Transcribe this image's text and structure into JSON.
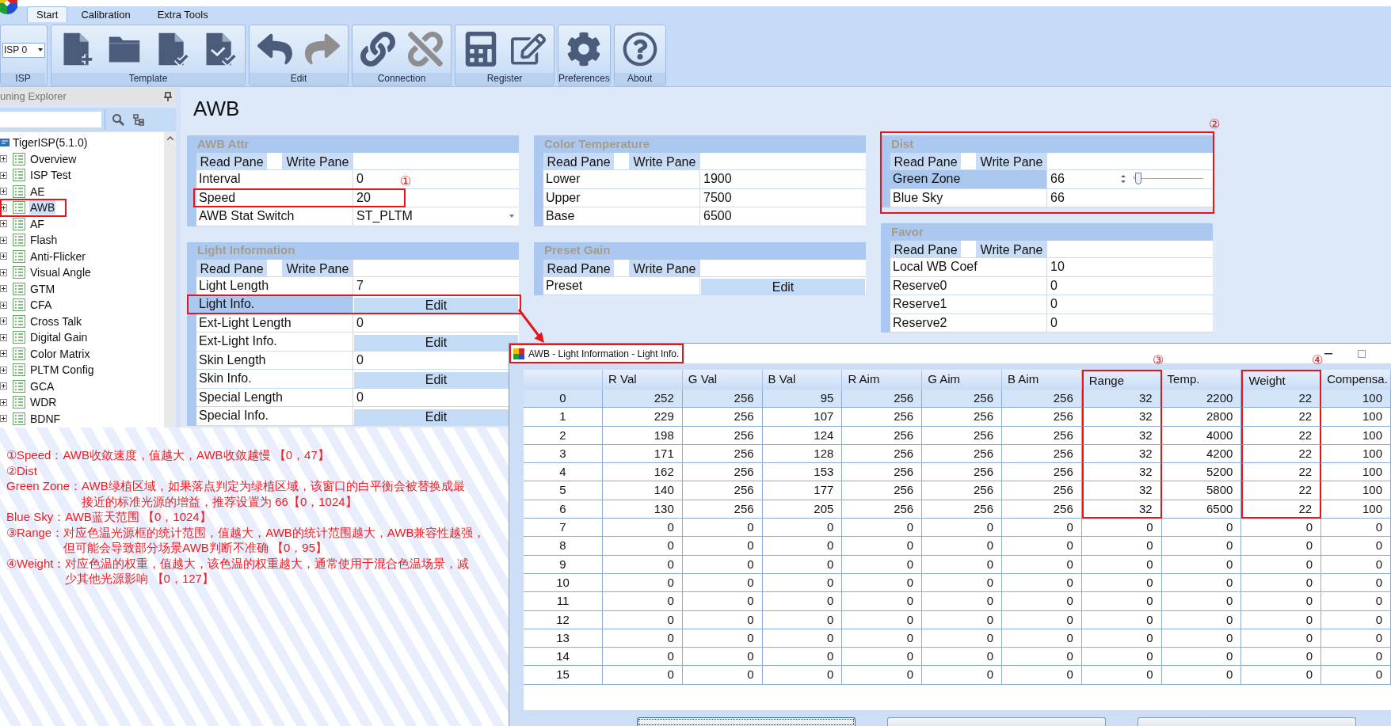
{
  "tabs": [
    {
      "label": "Start",
      "selected": true
    },
    {
      "label": "Calibration",
      "selected": false
    },
    {
      "label": "Extra Tools",
      "selected": false
    }
  ],
  "ribbon": {
    "groups": [
      {
        "kind": "select",
        "label": "ISP",
        "value": "ISP 0"
      },
      {
        "kind": "buttons",
        "label": "Template",
        "buttons": [
          {
            "kind": "new",
            "disabled": false
          },
          {
            "kind": "open",
            "disabled": false
          },
          {
            "kind": "save",
            "disabled": false
          },
          {
            "kind": "apply",
            "disabled": false
          }
        ]
      },
      {
        "kind": "buttons",
        "label": "Edit",
        "buttons": [
          {
            "kind": "undo",
            "disabled": false
          },
          {
            "kind": "redo",
            "disabled": true
          }
        ]
      },
      {
        "kind": "buttons",
        "label": "Connection",
        "buttons": [
          {
            "kind": "connect",
            "disabled": false
          },
          {
            "kind": "disconnect",
            "disabled": true
          }
        ]
      },
      {
        "kind": "buttons",
        "label": "Register",
        "buttons": [
          {
            "kind": "calculator",
            "disabled": false
          },
          {
            "kind": "edit",
            "disabled": false
          }
        ]
      },
      {
        "kind": "buttons",
        "label": "Preferences",
        "buttons": [
          {
            "kind": "settings",
            "disabled": false
          }
        ]
      },
      {
        "kind": "buttons",
        "label": "About",
        "buttons": [
          {
            "kind": "help",
            "disabled": false
          }
        ]
      }
    ]
  },
  "explorer": {
    "title": "uning Explorer",
    "tree": {
      "label": "TigerISP(5.1.0)",
      "children": [
        {
          "label": "Overview",
          "expanded": false,
          "selected": false,
          "marked": false
        },
        {
          "label": "ISP Test",
          "expanded": false,
          "selected": false,
          "marked": false
        },
        {
          "label": "AE",
          "expanded": false,
          "selected": false,
          "marked": false
        },
        {
          "label": "AWB",
          "expanded": false,
          "selected": true,
          "marked": true
        },
        {
          "label": "AF",
          "expanded": false,
          "selected": false,
          "marked": false
        },
        {
          "label": "Flash",
          "expanded": false,
          "selected": false,
          "marked": false
        },
        {
          "label": "Anti-Flicker",
          "expanded": false,
          "selected": false,
          "marked": false
        },
        {
          "label": "Visual Angle",
          "expanded": false,
          "selected": false,
          "marked": false
        },
        {
          "label": "GTM",
          "expanded": false,
          "selected": false,
          "marked": false
        },
        {
          "label": "CFA",
          "expanded": false,
          "selected": false,
          "marked": false
        },
        {
          "label": "Cross Talk",
          "expanded": false,
          "selected": false,
          "marked": false
        },
        {
          "label": "Digital Gain",
          "expanded": false,
          "selected": false,
          "marked": false
        },
        {
          "label": "Color Matrix",
          "expanded": false,
          "selected": false,
          "marked": false
        },
        {
          "label": "PLTM Config",
          "expanded": false,
          "selected": false,
          "marked": false
        },
        {
          "label": "GCA",
          "expanded": false,
          "selected": false,
          "marked": false
        },
        {
          "label": "WDR",
          "expanded": false,
          "selected": false,
          "marked": false
        },
        {
          "label": "BDNF",
          "expanded": false,
          "selected": false,
          "marked": false
        }
      ]
    }
  },
  "page": {
    "title": "AWB",
    "columns": [
      [
        {
          "title": "AWB Attr",
          "marked": false,
          "buttons": [
            "Read Pane",
            "Write Pane"
          ],
          "rows": [
            {
              "kind": "value",
              "label": "Interval",
              "value": "0",
              "selected": false,
              "marked": false
            },
            {
              "kind": "value",
              "label": "Speed",
              "value": "20",
              "selected": false,
              "marked": true,
              "callout": "①"
            },
            {
              "kind": "select",
              "label": "AWB Stat Switch",
              "value": "ST_PLTM",
              "selected": false,
              "marked": false
            }
          ]
        },
        {
          "title": "Light Information",
          "marked": false,
          "buttons": [
            "Read Pane",
            "Write Pane"
          ],
          "rows": [
            {
              "kind": "value",
              "label": "Light Length",
              "value": "7",
              "selected": false,
              "marked": false
            },
            {
              "kind": "button",
              "label": "Light Info.",
              "value": "Edit",
              "selected": true,
              "marked": true
            },
            {
              "kind": "value",
              "label": "Ext-Light Length",
              "value": "0",
              "selected": false,
              "marked": false
            },
            {
              "kind": "button",
              "label": "Ext-Light Info.",
              "value": "Edit",
              "selected": false,
              "marked": false
            },
            {
              "kind": "value",
              "label": "Skin Length",
              "value": "0",
              "selected": false,
              "marked": false
            },
            {
              "kind": "button",
              "label": "Skin Info.",
              "value": "Edit",
              "selected": false,
              "marked": false
            },
            {
              "kind": "value",
              "label": "Special Length",
              "value": "0",
              "selected": false,
              "marked": false
            },
            {
              "kind": "button",
              "label": "Special Info.",
              "value": "Edit",
              "selected": false,
              "marked": false
            }
          ]
        }
      ],
      [
        {
          "title": "Color Temperature",
          "marked": false,
          "buttons": [
            "Read Pane",
            "Write Pane"
          ],
          "rows": [
            {
              "kind": "value",
              "label": "Lower",
              "value": "1900",
              "selected": false,
              "marked": false
            },
            {
              "kind": "value",
              "label": "Upper",
              "value": "7500",
              "selected": false,
              "marked": false
            },
            {
              "kind": "value",
              "label": "Base",
              "value": "6500",
              "selected": false,
              "marked": false
            }
          ]
        },
        {
          "title": "Preset Gain",
          "marked": false,
          "buttons": [
            "Read Pane",
            "Write Pane"
          ],
          "rows": [
            {
              "kind": "button",
              "label": "Preset",
              "value": "Edit",
              "selected": false,
              "marked": false
            }
          ]
        }
      ],
      [
        {
          "title": "Dist",
          "marked": true,
          "callout": "②",
          "buttons": [
            "Read Pane",
            "Write Pane"
          ],
          "rows": [
            {
              "kind": "slider",
              "label": "Green Zone",
              "value": "66",
              "level": 0.065,
              "selected": true,
              "marked": false
            },
            {
              "kind": "value",
              "label": "Blue Sky",
              "value": "66",
              "selected": false,
              "marked": false
            }
          ]
        },
        {
          "title": "Favor",
          "marked": false,
          "buttons": [
            "Read Pane",
            "Write Pane"
          ],
          "rows": [
            {
              "kind": "value",
              "label": "Local WB Coef",
              "value": "10",
              "selected": false,
              "marked": false
            },
            {
              "kind": "value",
              "label": "Reserve0",
              "value": "0",
              "selected": false,
              "marked": false
            },
            {
              "kind": "value",
              "label": "Reserve1",
              "value": "0",
              "selected": false,
              "marked": false
            },
            {
              "kind": "value",
              "label": "Reserve2",
              "value": "0",
              "selected": false,
              "marked": false
            }
          ]
        }
      ]
    ]
  },
  "dialog": {
    "title": "AWB - Light Information - Light Info.",
    "title_marked": true,
    "columns": [
      {
        "label": "R Val",
        "marked": false
      },
      {
        "label": "G Val",
        "marked": false
      },
      {
        "label": "B Val",
        "marked": false
      },
      {
        "label": "R Aim",
        "marked": false
      },
      {
        "label": "G Aim",
        "marked": false
      },
      {
        "label": "B Aim",
        "marked": false
      },
      {
        "label": "Range",
        "marked": true,
        "callout": "③"
      },
      {
        "label": "Temp.",
        "marked": false
      },
      {
        "label": "Weight",
        "marked": true,
        "callout": "④"
      },
      {
        "label": "Compensa.",
        "marked": false
      }
    ],
    "rows": [
      {
        "index": "0",
        "selected": true,
        "marked": true,
        "cells": [
          "252",
          "256",
          "95",
          "256",
          "256",
          "256",
          "32",
          "2200",
          "22",
          "100"
        ]
      },
      {
        "index": "1",
        "selected": false,
        "marked": true,
        "cells": [
          "229",
          "256",
          "107",
          "256",
          "256",
          "256",
          "32",
          "2800",
          "22",
          "100"
        ]
      },
      {
        "index": "2",
        "selected": false,
        "marked": true,
        "cells": [
          "198",
          "256",
          "124",
          "256",
          "256",
          "256",
          "32",
          "4000",
          "22",
          "100"
        ]
      },
      {
        "index": "3",
        "selected": false,
        "marked": true,
        "cells": [
          "171",
          "256",
          "128",
          "256",
          "256",
          "256",
          "32",
          "4200",
          "22",
          "100"
        ]
      },
      {
        "index": "4",
        "selected": false,
        "marked": true,
        "cells": [
          "162",
          "256",
          "153",
          "256",
          "256",
          "256",
          "32",
          "5200",
          "22",
          "100"
        ]
      },
      {
        "index": "5",
        "selected": false,
        "marked": true,
        "cells": [
          "140",
          "256",
          "177",
          "256",
          "256",
          "256",
          "32",
          "5800",
          "22",
          "100"
        ]
      },
      {
        "index": "6",
        "selected": false,
        "marked": true,
        "cells": [
          "130",
          "256",
          "205",
          "256",
          "256",
          "256",
          "32",
          "6500",
          "22",
          "100"
        ]
      },
      {
        "index": "7",
        "selected": false,
        "marked": false,
        "cells": [
          "0",
          "0",
          "0",
          "0",
          "0",
          "0",
          "0",
          "0",
          "0",
          "0"
        ]
      },
      {
        "index": "8",
        "selected": false,
        "marked": false,
        "cells": [
          "0",
          "0",
          "0",
          "0",
          "0",
          "0",
          "0",
          "0",
          "0",
          "0"
        ]
      },
      {
        "index": "9",
        "selected": false,
        "marked": false,
        "cells": [
          "0",
          "0",
          "0",
          "0",
          "0",
          "0",
          "0",
          "0",
          "0",
          "0"
        ]
      },
      {
        "index": "10",
        "selected": false,
        "marked": false,
        "cells": [
          "0",
          "0",
          "0",
          "0",
          "0",
          "0",
          "0",
          "0",
          "0",
          "0"
        ]
      },
      {
        "index": "11",
        "selected": false,
        "marked": false,
        "cells": [
          "0",
          "0",
          "0",
          "0",
          "0",
          "0",
          "0",
          "0",
          "0",
          "0"
        ]
      },
      {
        "index": "12",
        "selected": false,
        "marked": false,
        "cells": [
          "0",
          "0",
          "0",
          "0",
          "0",
          "0",
          "0",
          "0",
          "0",
          "0"
        ]
      },
      {
        "index": "13",
        "selected": false,
        "marked": false,
        "cells": [
          "0",
          "0",
          "0",
          "0",
          "0",
          "0",
          "0",
          "0",
          "0",
          "0"
        ]
      },
      {
        "index": "14",
        "selected": false,
        "marked": false,
        "cells": [
          "0",
          "0",
          "0",
          "0",
          "0",
          "0",
          "0",
          "0",
          "0",
          "0"
        ]
      },
      {
        "index": "15",
        "selected": false,
        "marked": false,
        "cells": [
          "0",
          "0",
          "0",
          "0",
          "0",
          "0",
          "0",
          "0",
          "0",
          "0"
        ]
      }
    ],
    "buttons": [
      {
        "focused": true
      },
      {
        "focused": false
      },
      {
        "focused": false
      }
    ]
  },
  "notes": [
    {
      "label": "①Speed：",
      "lines": [
        "AWB收敛速度，值越大，AWB收敛越慢 【0，47】"
      ]
    },
    {
      "label": "②Dist"
    },
    {
      "label": "Green Zone：",
      "lines": [
        "AWB绿植区域，如果落点判定为绿植区域，该窗口的白平衡会被替换成最",
        "接近的标准光源的增益，推荐设置为 66【0，1024】"
      ]
    },
    {
      "label": "Blue Sky：",
      "lines": [
        "AWB蓝天范围 【0，1024】"
      ]
    },
    {
      "label": "③Range：",
      "lines": [
        "对应色温光源框的统计范围，值越大，AWB的统计范围越大，AWB兼容性越强，",
        "但可能会导致部分场景AWB判断不准确 【0，95】"
      ]
    },
    {
      "label": "④Weight：",
      "lines": [
        "对应色温的权重，值越大，该色温的权重越大，通常使用于混合色温场景，减",
        "少其他光源影响 【0，127】"
      ]
    }
  ]
}
